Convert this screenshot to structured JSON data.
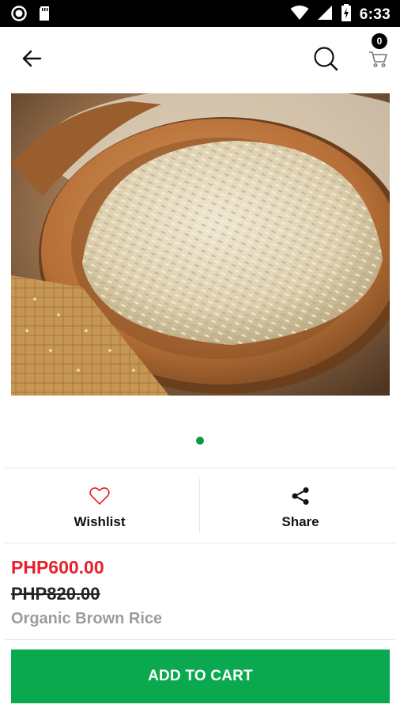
{
  "status_bar": {
    "time": "6:33",
    "icons": [
      "record-icon",
      "sd-card-icon",
      "wifi-icon",
      "cellular-signal-icon",
      "battery-charging-icon"
    ]
  },
  "app_bar": {
    "back_icon": "arrow-back-icon",
    "search_icon": "search-icon",
    "cart_icon": "cart-icon",
    "cart_count": "0"
  },
  "product": {
    "image": "brown-rice-in-wooden-bowl",
    "carousel": {
      "total": 1,
      "active": 1
    },
    "price_now": "PHP600.00",
    "price_old": "PHP820.00",
    "name": "Organic Brown Rice"
  },
  "actions": {
    "wishlist_label": "Wishlist",
    "share_label": "Share"
  },
  "cta": {
    "add_to_cart_label": "ADD TO CART"
  },
  "colors": {
    "accent_green": "#0aa84f",
    "price_red": "#e8202a",
    "wishlist_heart": "#e8202a"
  }
}
